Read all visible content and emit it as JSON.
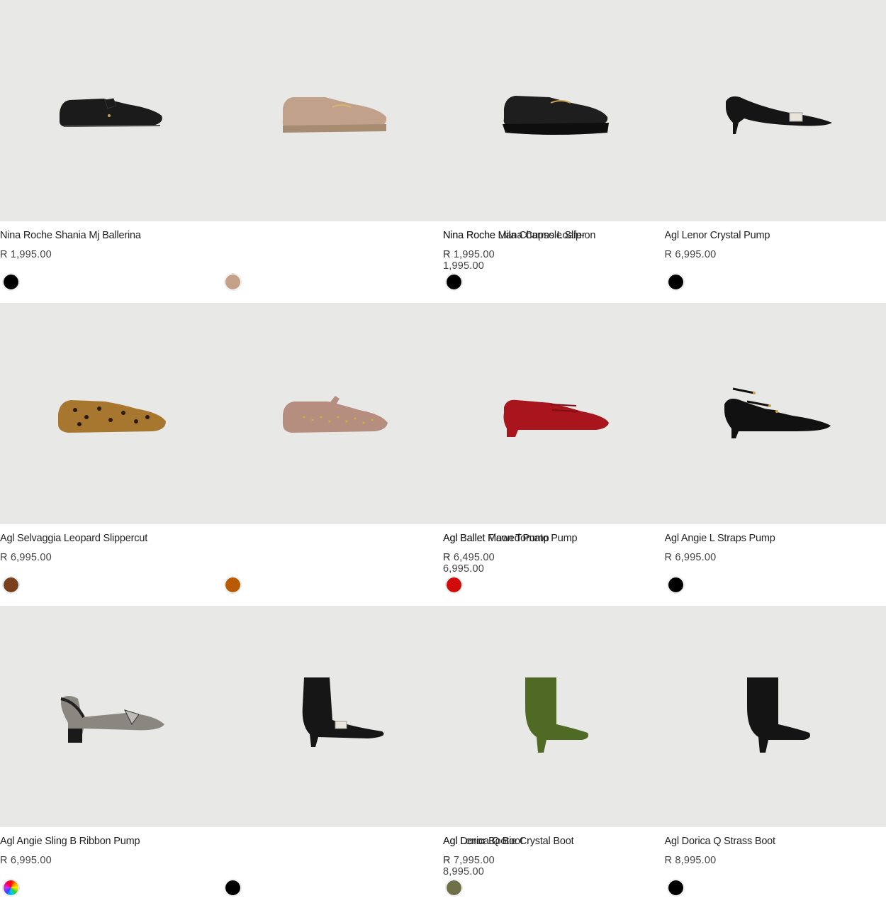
{
  "products": [
    {
      "name": "Nina Roche Shania Mj Ballerina",
      "price": "R 1,995.00",
      "color": "#000000",
      "shoe": "ballerina",
      "shade": "#1b1b1b"
    },
    {
      "name": "Nina Roche Mila Charms Loafer",
      "price": "R 1,995.00",
      "color": "#c4a088",
      "shoe": "loafer",
      "shade": "#c1a18b"
    },
    {
      "name": "Nina Roche Liana Cupsole Slip-on",
      "price": "R 1,995.00",
      "color": "#000000",
      "shoe": "slipon",
      "shade": "#1e1e1e"
    },
    {
      "name": "Agl Lenor Crystal Pump",
      "price": "R 6,995.00",
      "color": "#000000",
      "shoe": "kitten",
      "shade": "#151515"
    },
    {
      "name": "Agl Selvaggia Leopard Slippercut",
      "price": "R 6,995.00",
      "color": "#7a3f1c",
      "shoe": "leopard",
      "shade": "#a8772f"
    },
    {
      "name": "Agl Ballet Flawed Pump",
      "price": "R 6,995.00",
      "color": "#b85a06",
      "shoe": "studded",
      "shade": "#b68e80"
    },
    {
      "name": "Agl Ballet Moon Tomato Pump",
      "price": "R 6,495.00",
      "color": "#d10a0a",
      "shoe": "maryjane",
      "shade": "#a9151c"
    },
    {
      "name": "Agl Angie L Straps Pump",
      "price": "R 6,995.00",
      "color": "#000000",
      "shoe": "straps",
      "shade": "#111111"
    },
    {
      "name": "Agl Angie Sling B Ribbon Pump",
      "price": "R 6,995.00",
      "color": "multi",
      "shoe": "slingback",
      "shade": "#8a8680"
    },
    {
      "name": "Agl Lenor Bootie Crystal Boot",
      "price": "R 8,995.00",
      "color": "#000000",
      "shoe": "bootie",
      "shade": "#161616"
    },
    {
      "name": "Agl Dorica Q Boot",
      "price": "R 7,995.00",
      "color": "#6e7048",
      "shoe": "boot",
      "shade": "#4f6a24"
    },
    {
      "name": "Agl Dorica Q Strass Boot",
      "price": "R 8,995.00",
      "color": "#000000",
      "shoe": "boot",
      "shade": "#141414"
    }
  ]
}
